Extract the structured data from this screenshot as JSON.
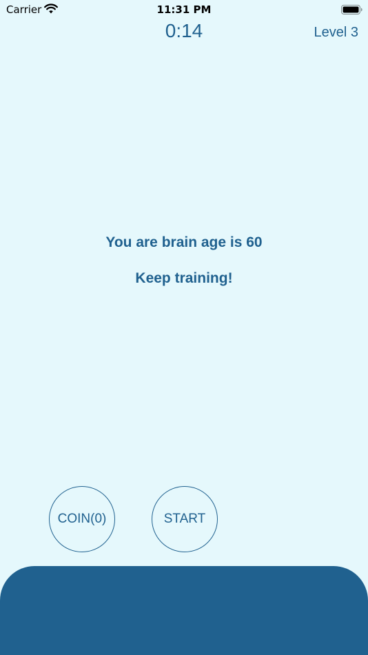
{
  "status_bar": {
    "carrier": "Carrier",
    "time": "11:31 PM",
    "wifi_icon": "wifi-icon",
    "battery_icon": "battery-full-icon"
  },
  "header": {
    "timer": "0:14",
    "level": "Level 3"
  },
  "result": {
    "message": "You are brain age is 60",
    "encouragement": "Keep training!"
  },
  "buttons": {
    "coin_label": "COIN(0)",
    "start_label": "START"
  },
  "colors": {
    "background": "#e5f8fc",
    "accent": "#20618f"
  }
}
